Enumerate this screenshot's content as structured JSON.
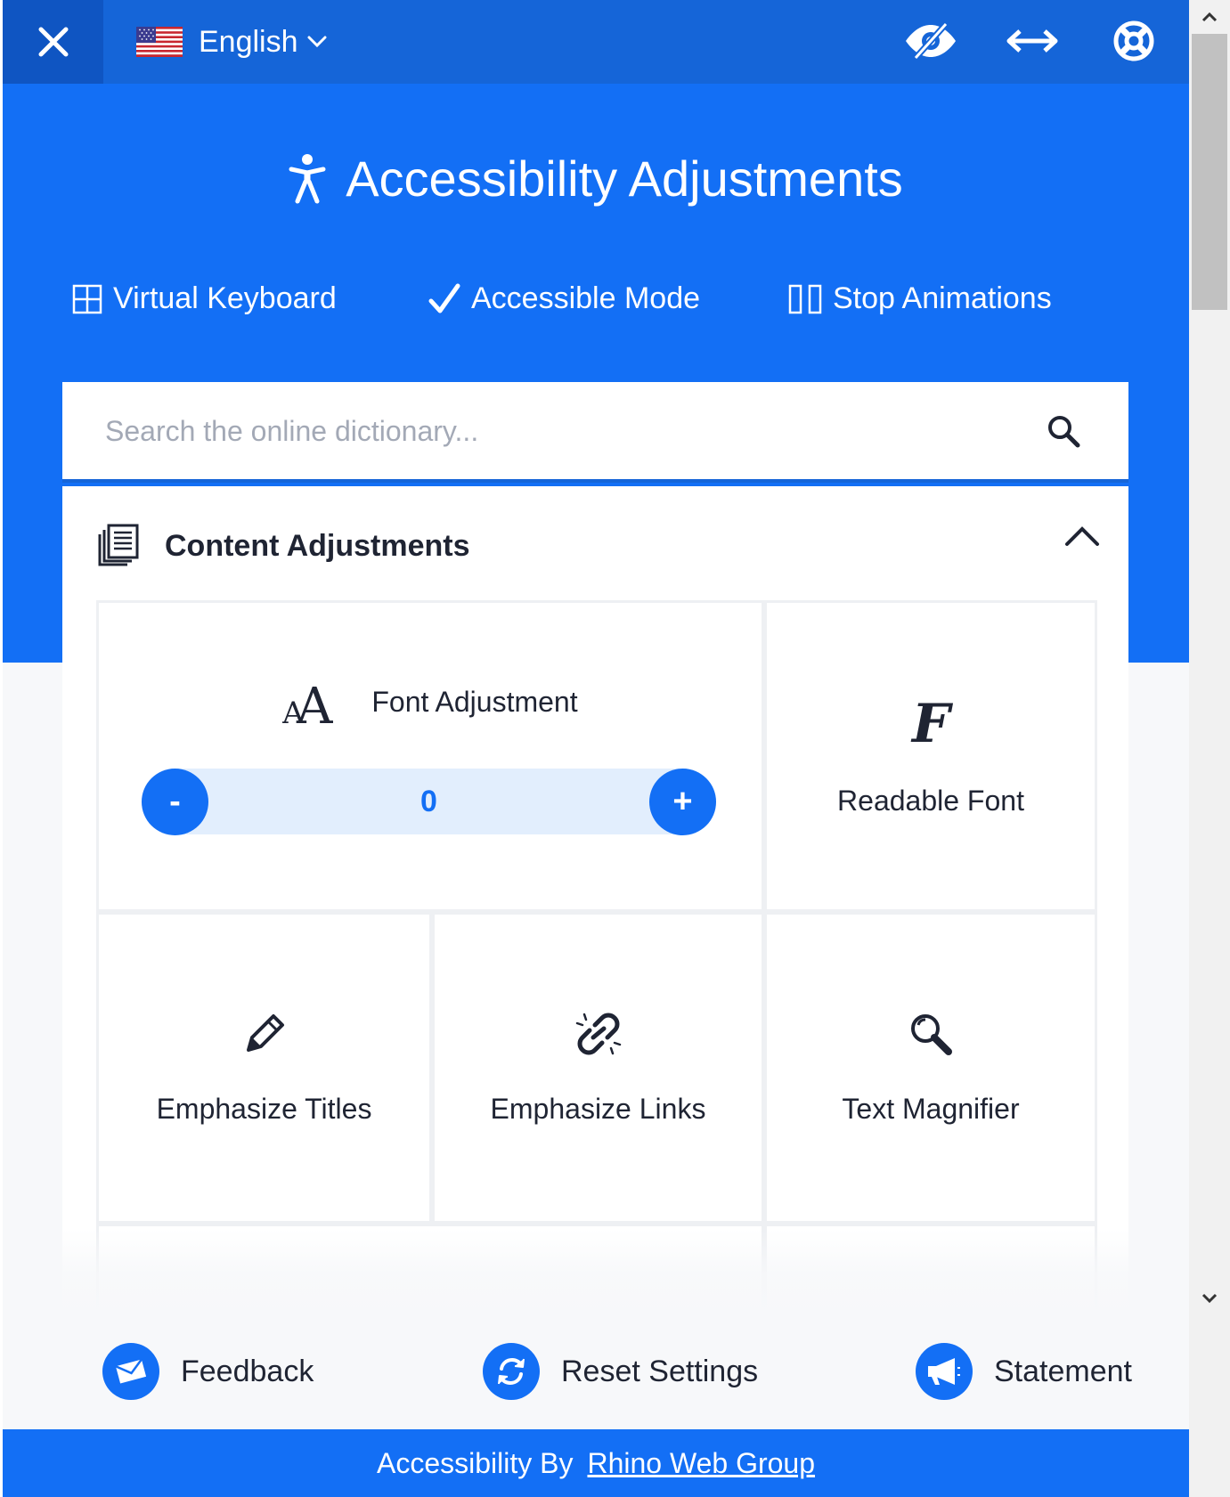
{
  "app": {
    "close_icon": "close-icon",
    "language": {
      "label": "English",
      "flag_icon": "us-flag-icon"
    },
    "top_icons": [
      "hide-interface-icon",
      "oversize-widget-icon",
      "help-lifebuoy-icon"
    ]
  },
  "header": {
    "title": "Accessibility Adjustments",
    "quick_actions": [
      {
        "label": "Virtual Keyboard",
        "icon": "keyboard-grid-icon"
      },
      {
        "label": "Accessible Mode",
        "icon": "checkmark-icon"
      },
      {
        "label": "Stop Animations",
        "icon": "pause-icon"
      }
    ]
  },
  "search": {
    "placeholder": "Search the online dictionary...",
    "value": ""
  },
  "content_section": {
    "title": "Content Adjustments",
    "expanded": true,
    "font_adjustment": {
      "label": "Font Adjustment",
      "value": "0",
      "decrease_label": "-",
      "increase_label": "+"
    },
    "tiles": [
      {
        "label": "Readable Font",
        "icon": "readable-font-icon"
      },
      {
        "label": "Emphasize Titles",
        "icon": "pencil-icon"
      },
      {
        "label": "Emphasize Links",
        "icon": "link-icon"
      },
      {
        "label": "Text Magnifier",
        "icon": "magnifier-icon"
      }
    ]
  },
  "actions": [
    {
      "label": "Feedback",
      "icon": "envelope-icon"
    },
    {
      "label": "Reset Settings",
      "icon": "refresh-icon"
    },
    {
      "label": "Statement",
      "icon": "megaphone-icon"
    }
  ],
  "footer": {
    "prefix": "Accessibility By",
    "link_text": "Rhino Web Group"
  },
  "colors": {
    "primary": "#136ff5",
    "topbar": "#1565d8",
    "close_bg": "#0f55c2",
    "stepper_track": "#e2eefd",
    "text": "#1f2433"
  }
}
